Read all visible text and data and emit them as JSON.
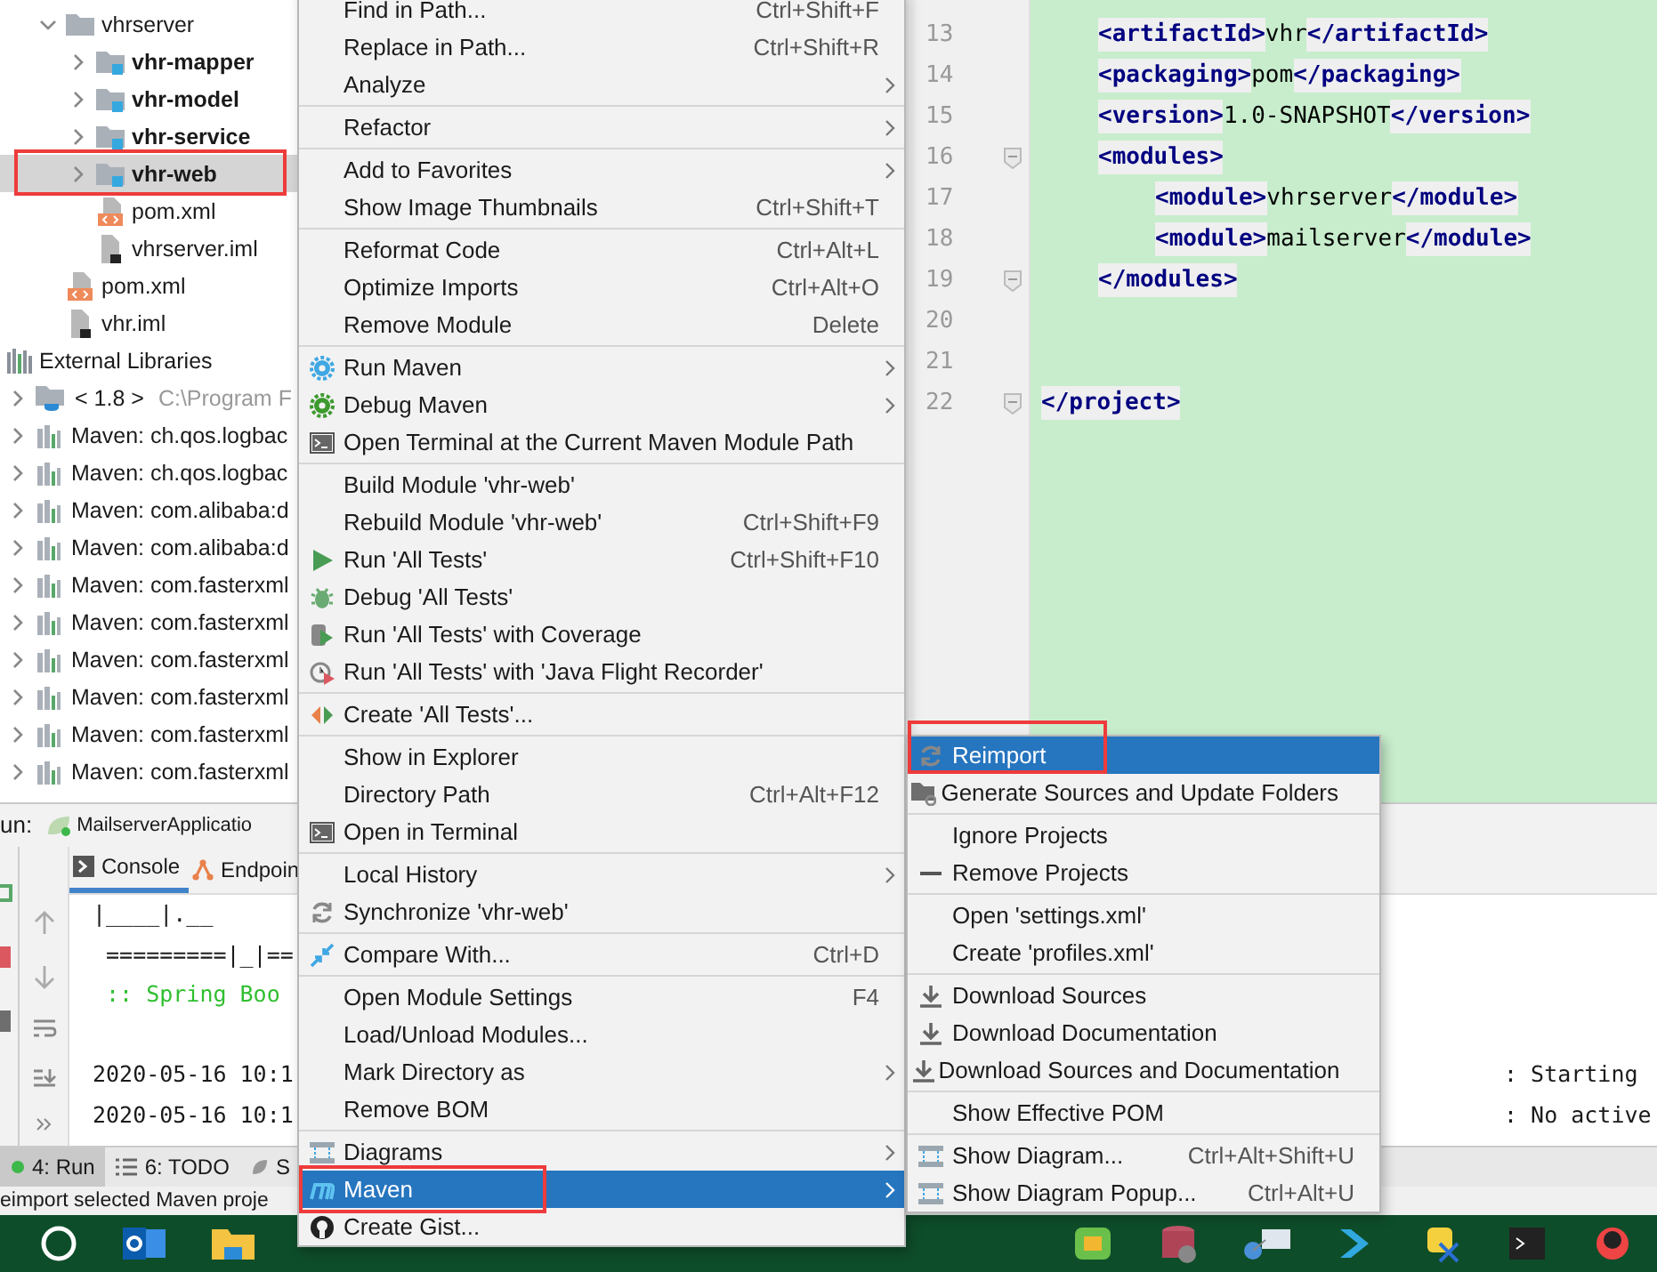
{
  "project_tree": {
    "items": [
      {
        "label": "vhrserver",
        "kind": "folder",
        "expanded": true,
        "selected": false,
        "annotated": false,
        "children": [
          {
            "label": "vhr-mapper",
            "kind": "module",
            "expanded": false,
            "selected": false,
            "annotated": false
          },
          {
            "label": "vhr-model",
            "kind": "module",
            "expanded": false,
            "selected": false,
            "annotated": false
          },
          {
            "label": "vhr-service",
            "kind": "module",
            "expanded": false,
            "selected": false,
            "annotated": false
          },
          {
            "label": "vhr-web",
            "kind": "module",
            "expanded": false,
            "selected": true,
            "annotated": true
          },
          {
            "label": "pom.xml",
            "kind": "pom",
            "selected": false,
            "annotated": false
          },
          {
            "label": "vhrserver.iml",
            "kind": "iml",
            "selected": false,
            "annotated": false
          }
        ]
      },
      {
        "label": "pom.xml",
        "kind": "pom",
        "selected": false,
        "annotated": false
      },
      {
        "label": "vhr.iml",
        "kind": "iml",
        "selected": false,
        "annotated": false
      }
    ]
  },
  "external_libraries": {
    "label": "External Libraries",
    "expanded": true,
    "children": [
      {
        "label": "< 1.8 >",
        "detail": "C:\\Program F",
        "kind": "jdk",
        "expanded": false
      },
      {
        "label": "Maven: ch.qos.logbac",
        "kind": "library",
        "expanded": false
      },
      {
        "label": "Maven: ch.qos.logbac",
        "kind": "library",
        "expanded": false
      },
      {
        "label": "Maven: com.alibaba:d",
        "kind": "library",
        "expanded": false
      },
      {
        "label": "Maven: com.alibaba:d",
        "kind": "library",
        "expanded": false
      },
      {
        "label": "Maven: com.fasterxml",
        "kind": "library",
        "expanded": false
      },
      {
        "label": "Maven: com.fasterxml",
        "kind": "library",
        "expanded": false
      },
      {
        "label": "Maven: com.fasterxml",
        "kind": "library",
        "expanded": false
      },
      {
        "label": "Maven: com.fasterxml",
        "kind": "library",
        "expanded": false
      },
      {
        "label": "Maven: com.fasterxml",
        "kind": "library",
        "expanded": false
      },
      {
        "label": "Maven: com.fasterxml",
        "kind": "library",
        "expanded": false
      }
    ]
  },
  "editor": {
    "body_lines": [
      {
        "number": "13",
        "fold": false,
        "tokens": [
          {
            "kind": "tag",
            "text": "<artifactId>"
          },
          {
            "kind": "text",
            "text": "vhr"
          },
          {
            "kind": "tag",
            "text": "</artifactId>"
          }
        ]
      },
      {
        "number": "14",
        "fold": false,
        "tokens": [
          {
            "kind": "tag",
            "text": "<packaging>"
          },
          {
            "kind": "text",
            "text": "pom"
          },
          {
            "kind": "tag",
            "text": "</packaging>"
          }
        ]
      },
      {
        "number": "15",
        "fold": false,
        "tokens": [
          {
            "kind": "tag",
            "text": "<version>"
          },
          {
            "kind": "text",
            "text": "1.0-SNAPSHOT"
          },
          {
            "kind": "tag",
            "text": "</version>"
          }
        ]
      },
      {
        "number": "16",
        "fold": true,
        "tokens": [
          {
            "kind": "tag",
            "text": "<modules>"
          }
        ],
        "children": [
          {
            "number": "17",
            "fold": false,
            "tokens": [
              {
                "kind": "tag",
                "text": "<module>"
              },
              {
                "kind": "text",
                "text": "vhrserver"
              },
              {
                "kind": "tag",
                "text": "</module>"
              }
            ]
          },
          {
            "number": "18",
            "fold": false,
            "tokens": [
              {
                "kind": "tag",
                "text": "<module>"
              },
              {
                "kind": "text",
                "text": "mailserver"
              },
              {
                "kind": "tag",
                "text": "</module>"
              }
            ]
          }
        ]
      },
      {
        "number": "19",
        "fold": true,
        "tokens": [
          {
            "kind": "tag",
            "text": "</modules>"
          }
        ]
      },
      {
        "number": "20",
        "fold": false
      },
      {
        "number": "21",
        "fold": false
      }
    ],
    "closing_lines": [
      {
        "number": "22",
        "fold": true,
        "tokens": [
          {
            "kind": "tag",
            "text": "</project>"
          }
        ]
      }
    ]
  },
  "run_panel": {
    "label": "un:",
    "config_tab": "MailserverApplicatio",
    "tabs": [
      {
        "label": "Console",
        "selected": true
      },
      {
        "label": "Endpoin",
        "selected": false
      }
    ],
    "console_lines": [
      {
        "kind": "plain",
        "text": "|____|.__"
      },
      {
        "kind": "plain",
        "text": " =========|_|=="
      },
      {
        "kind": "banner",
        "text": " :: Spring Boo"
      },
      {
        "kind": "blank"
      },
      {
        "kind": "plain",
        "text": "2020-05-16 10:1",
        "right": ": Starting"
      },
      {
        "kind": "plain",
        "text": "2020-05-16 10:1",
        "right": ": No active"
      }
    ]
  },
  "tool_tabs": [
    {
      "label": "4: Run",
      "selected": true
    },
    {
      "label": "6: TODO",
      "selected": false
    },
    {
      "label": "S",
      "selected": false
    }
  ],
  "status_bar": "eimport selected Maven proje",
  "context_menu": [
    {
      "kind": "item",
      "label": "Find in Path...",
      "shortcut": "Ctrl+Shift+F",
      "submenu": false,
      "selected": false,
      "annotated": false
    },
    {
      "kind": "item",
      "label": "Replace in Path...",
      "shortcut": "Ctrl+Shift+R",
      "submenu": false,
      "selected": false,
      "annotated": false
    },
    {
      "kind": "item",
      "label": "Analyze",
      "submenu": true,
      "selected": false,
      "annotated": false
    },
    {
      "kind": "separator"
    },
    {
      "kind": "item",
      "label": "Refactor",
      "submenu": true,
      "selected": false,
      "annotated": false
    },
    {
      "kind": "separator"
    },
    {
      "kind": "item",
      "label": "Add to Favorites",
      "submenu": true,
      "selected": false,
      "annotated": false
    },
    {
      "kind": "item",
      "label": "Show Image Thumbnails",
      "shortcut": "Ctrl+Shift+T",
      "submenu": false,
      "selected": false,
      "annotated": false
    },
    {
      "kind": "separator"
    },
    {
      "kind": "item",
      "label": "Reformat Code",
      "shortcut": "Ctrl+Alt+L",
      "submenu": false,
      "selected": false,
      "annotated": false
    },
    {
      "kind": "item",
      "label": "Optimize Imports",
      "shortcut": "Ctrl+Alt+O",
      "submenu": false,
      "selected": false,
      "annotated": false
    },
    {
      "kind": "item",
      "label": "Remove Module",
      "shortcut": "Delete",
      "submenu": false,
      "selected": false,
      "annotated": false
    },
    {
      "kind": "separator"
    },
    {
      "kind": "item",
      "label": "Run Maven",
      "submenu": true,
      "selected": false,
      "annotated": false
    },
    {
      "kind": "item",
      "label": "Debug Maven",
      "submenu": true,
      "selected": false,
      "annotated": false
    },
    {
      "kind": "item",
      "label": "Open Terminal at the Current Maven Module Path",
      "submenu": false,
      "selected": false,
      "annotated": false
    },
    {
      "kind": "separator"
    },
    {
      "kind": "item",
      "label": "Build Module 'vhr-web'",
      "submenu": false,
      "selected": false,
      "annotated": false
    },
    {
      "kind": "item",
      "label": "Rebuild Module 'vhr-web'",
      "shortcut": "Ctrl+Shift+F9",
      "submenu": false,
      "selected": false,
      "annotated": false
    },
    {
      "kind": "item",
      "label": "Run 'All Tests'",
      "shortcut": "Ctrl+Shift+F10",
      "submenu": false,
      "selected": false,
      "annotated": false
    },
    {
      "kind": "item",
      "label": "Debug 'All Tests'",
      "submenu": false,
      "selected": false,
      "annotated": false
    },
    {
      "kind": "item",
      "label": "Run 'All Tests' with Coverage",
      "submenu": false,
      "selected": false,
      "annotated": false
    },
    {
      "kind": "item",
      "label": "Run 'All Tests' with 'Java Flight Recorder'",
      "submenu": false,
      "selected": false,
      "annotated": false
    },
    {
      "kind": "separator"
    },
    {
      "kind": "item",
      "label": "Create 'All Tests'...",
      "submenu": false,
      "selected": false,
      "annotated": false
    },
    {
      "kind": "separator"
    },
    {
      "kind": "item",
      "label": "Show in Explorer",
      "submenu": false,
      "selected": false,
      "annotated": false
    },
    {
      "kind": "item",
      "label": "Directory Path",
      "shortcut": "Ctrl+Alt+F12",
      "submenu": false,
      "selected": false,
      "annotated": false
    },
    {
      "kind": "item",
      "label": "Open in Terminal",
      "submenu": false,
      "selected": false,
      "annotated": false
    },
    {
      "kind": "separator"
    },
    {
      "kind": "item",
      "label": "Local History",
      "submenu": true,
      "selected": false,
      "annotated": false
    },
    {
      "kind": "item",
      "label": "Synchronize 'vhr-web'",
      "submenu": false,
      "selected": false,
      "annotated": false
    },
    {
      "kind": "separator"
    },
    {
      "kind": "item",
      "label": "Compare With...",
      "shortcut": "Ctrl+D",
      "submenu": false,
      "selected": false,
      "annotated": false
    },
    {
      "kind": "separator"
    },
    {
      "kind": "item",
      "label": "Open Module Settings",
      "shortcut": "F4",
      "submenu": false,
      "selected": false,
      "annotated": false
    },
    {
      "kind": "item",
      "label": "Load/Unload Modules...",
      "submenu": false,
      "selected": false,
      "annotated": false
    },
    {
      "kind": "item",
      "label": "Mark Directory as",
      "submenu": true,
      "selected": false,
      "annotated": false
    },
    {
      "kind": "item",
      "label": "Remove BOM",
      "submenu": false,
      "selected": false,
      "annotated": false
    },
    {
      "kind": "separator"
    },
    {
      "kind": "item",
      "label": "Diagrams",
      "submenu": true,
      "selected": false,
      "annotated": false
    },
    {
      "kind": "item",
      "label": "Maven",
      "submenu": true,
      "selected": true,
      "annotated": true
    },
    {
      "kind": "item",
      "label": "Create Gist...",
      "submenu": false,
      "selected": false,
      "annotated": false
    }
  ],
  "maven_submenu": [
    {
      "kind": "item",
      "label": "Reimport",
      "submenu": false,
      "selected": true,
      "annotated": true
    },
    {
      "kind": "item",
      "label": "Generate Sources and Update Folders",
      "submenu": false,
      "selected": false,
      "annotated": false
    },
    {
      "kind": "separator"
    },
    {
      "kind": "item",
      "label": "Ignore Projects",
      "submenu": false,
      "selected": false,
      "annotated": false
    },
    {
      "kind": "item",
      "label": "Remove Projects",
      "submenu": false,
      "selected": false,
      "annotated": false
    },
    {
      "kind": "separator"
    },
    {
      "kind": "item",
      "label": "Open 'settings.xml'",
      "submenu": false,
      "selected": false,
      "annotated": false
    },
    {
      "kind": "item",
      "label": "Create 'profiles.xml'",
      "submenu": false,
      "selected": false,
      "annotated": false
    },
    {
      "kind": "separator"
    },
    {
      "kind": "item",
      "label": "Download Sources",
      "submenu": false,
      "selected": false,
      "annotated": false
    },
    {
      "kind": "item",
      "label": "Download Documentation",
      "submenu": false,
      "selected": false,
      "annotated": false
    },
    {
      "kind": "item",
      "label": "Download Sources and Documentation",
      "submenu": false,
      "selected": false,
      "annotated": false
    },
    {
      "kind": "separator"
    },
    {
      "kind": "item",
      "label": "Show Effective POM",
      "submenu": false,
      "selected": false,
      "annotated": false
    },
    {
      "kind": "separator"
    },
    {
      "kind": "item",
      "label": "Show Diagram...",
      "shortcut": "Ctrl+Alt+Shift+U",
      "submenu": false,
      "selected": false,
      "annotated": false
    },
    {
      "kind": "item",
      "label": "Show Diagram Popup...",
      "shortcut": "Ctrl+Alt+U",
      "submenu": false,
      "selected": false,
      "annotated": false
    }
  ]
}
